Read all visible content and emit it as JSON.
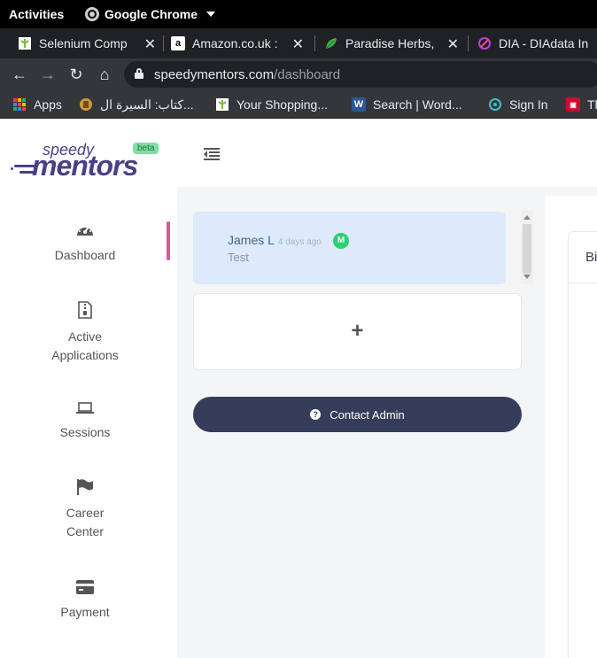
{
  "os": {
    "activities_label": "Activities",
    "app_name": "Google Chrome"
  },
  "tabs": [
    {
      "title": "Selenium Comp",
      "icon": "selenium-icon",
      "close": "✕"
    },
    {
      "title": "Amazon.co.uk :",
      "icon": "amazon-icon",
      "close": "✕"
    },
    {
      "title": "Paradise Herbs,",
      "icon": "leaf-icon",
      "close": "✕"
    },
    {
      "title": "DIA - DIAdata In",
      "icon": "dia-icon",
      "close": ""
    }
  ],
  "toolbar": {
    "back": "←",
    "forward": "→",
    "reload": "↻",
    "home": "⌂",
    "url_host": "speedymentors.com",
    "url_path": "/dashboard"
  },
  "bookmarks": [
    {
      "label": "Apps",
      "icon": "apps-grid-icon"
    },
    {
      "label": "كتاب: السيرة ال...",
      "icon": "book-icon"
    },
    {
      "label": "Your Shopping...",
      "icon": "selenium-icon"
    },
    {
      "label": "Search | Word...",
      "icon": "word-icon"
    },
    {
      "label": "Sign In",
      "icon": "signin-icon"
    },
    {
      "label": "Th",
      "icon": "news-icon"
    }
  ],
  "logo": {
    "speedy": "speedy",
    "mentors": "mentors",
    "beta": "beta"
  },
  "sidebar": {
    "items": [
      {
        "label": "Dashboard",
        "icon": "gauge-icon",
        "active": true
      },
      {
        "label": "Active Applications",
        "line1": "Active",
        "line2": "Applications",
        "icon": "file-zip-icon"
      },
      {
        "label": "Sessions",
        "icon": "laptop-icon"
      },
      {
        "label": "Career Center",
        "line1": "Career",
        "line2": "Center",
        "icon": "flag-icon"
      },
      {
        "label": "Payment",
        "icon": "credit-card-icon"
      }
    ]
  },
  "chat": {
    "name": "James L",
    "time_ago": "4 days ago",
    "badge": "M",
    "message": "Test",
    "add_label": "+"
  },
  "contact_button": {
    "label": "Contact Admin",
    "icon_glyph": "?"
  },
  "right_panel": {
    "header_text": "Bi"
  }
}
